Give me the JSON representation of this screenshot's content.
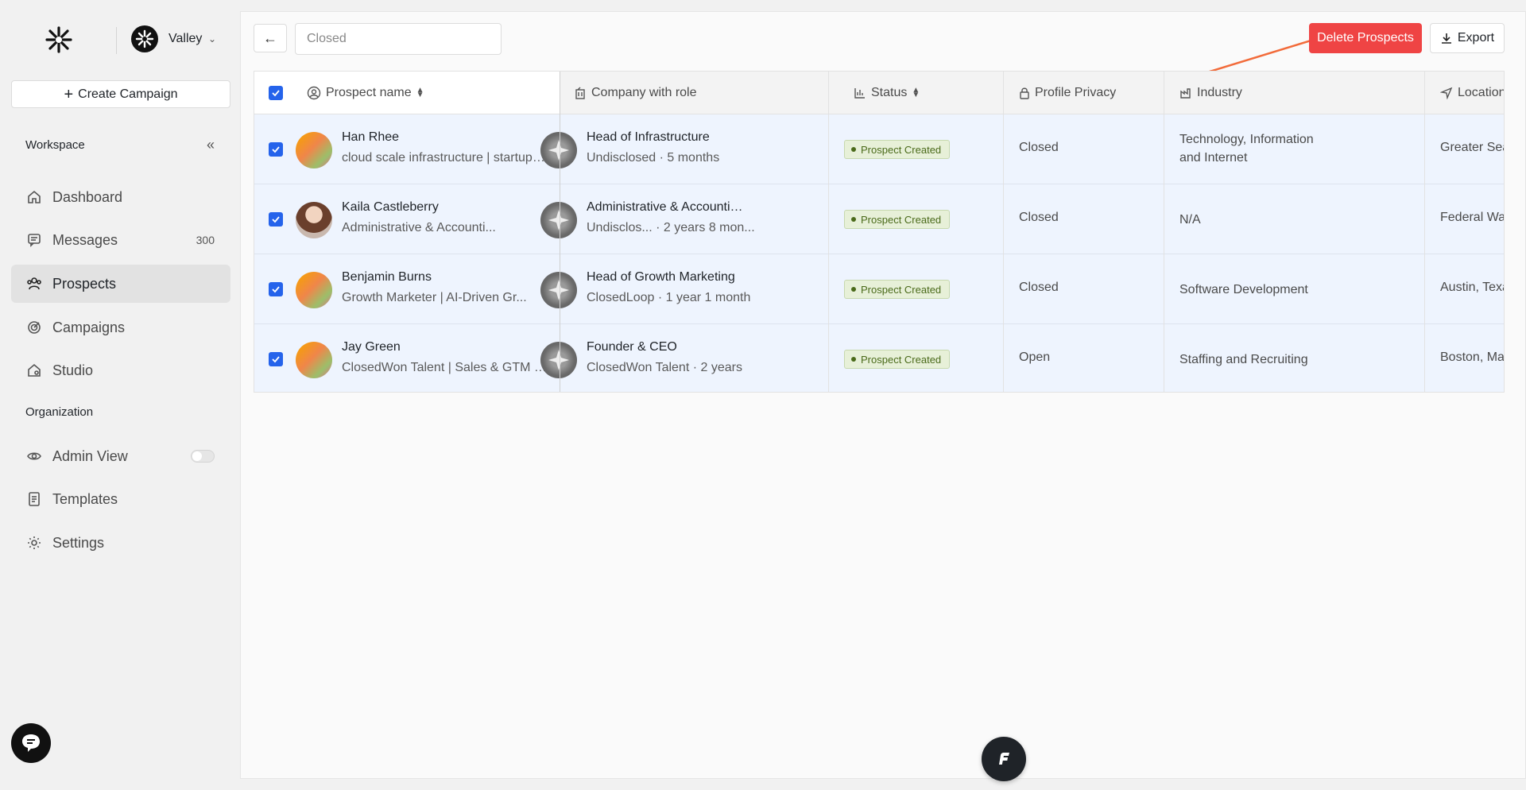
{
  "brand": {
    "org_name": "Valley"
  },
  "sidebar": {
    "create_campaign": "Create Campaign",
    "workspace_label": "Workspace",
    "organization_label": "Organization",
    "items": [
      {
        "label": "Dashboard",
        "icon": "home-icon"
      },
      {
        "label": "Messages",
        "icon": "message-icon",
        "count": "300"
      },
      {
        "label": "Prospects",
        "icon": "users-icon",
        "active": true
      },
      {
        "label": "Campaigns",
        "icon": "target-icon"
      },
      {
        "label": "Studio",
        "icon": "studio-icon"
      }
    ],
    "org_items": [
      {
        "label": "Admin View",
        "icon": "eye-icon",
        "toggle": false
      },
      {
        "label": "Templates",
        "icon": "document-icon"
      },
      {
        "label": "Settings",
        "icon": "gear-icon"
      }
    ]
  },
  "toolbar": {
    "filter_value": "Closed",
    "delete_label": "Delete Prospects",
    "export_label": "Export"
  },
  "table": {
    "columns": [
      "Prospect name",
      "Company with role",
      "Status",
      "Profile Privacy",
      "Industry",
      "Location"
    ],
    "rows": [
      {
        "name": "Han Rhee",
        "headline": "cloud scale infrastructure | startups ...",
        "role": "Head of Infrastructure",
        "company": "Undisclosed · 5 months",
        "status": "Prospect Created",
        "privacy": "Closed",
        "industry_line1": "Technology, Information",
        "industry_line2": "and Internet",
        "location": "Greater Sea"
      },
      {
        "name": "Kaila Castleberry",
        "headline": "Administrative & Accounti...",
        "role": "Administrative & Accountin...",
        "company": "Undisclos... · 2 years 8 mon...",
        "status": "Prospect Created",
        "privacy": "Closed",
        "industry_line1": "N/A",
        "industry_line2": "",
        "location": "Federal Way"
      },
      {
        "name": "Benjamin Burns",
        "headline": "Growth Marketer | AI-Driven Gr...",
        "role": "Head of Growth Marketing",
        "company": "ClosedLoop · 1 year 1 month",
        "status": "Prospect Created",
        "privacy": "Closed",
        "industry_line1": "Software Development",
        "industry_line2": "",
        "location": "Austin, Texa"
      },
      {
        "name": "Jay Green",
        "headline": "ClosedWon Talent | Sales & GTM R...",
        "role": "Founder & CEO",
        "company": "ClosedWon Talent · 2 years",
        "status": "Prospect Created",
        "privacy": "Open",
        "industry_line1": "Staffing and Recruiting",
        "industry_line2": "",
        "location": "Boston, Mas"
      }
    ]
  },
  "colors": {
    "danger": "#ef4444",
    "checkbox": "#2563eb",
    "row_selected": "#eef4fe",
    "annotation_arrow": "#f26b3a"
  }
}
